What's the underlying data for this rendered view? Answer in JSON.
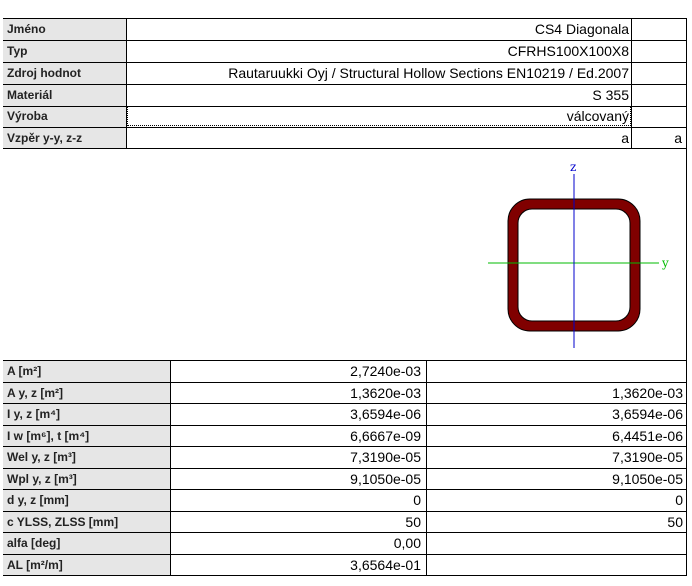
{
  "header_rows": [
    {
      "label": "Jméno",
      "value": "CS4 Diagonala"
    },
    {
      "label": "Typ",
      "value": "CFRHS100X100X8"
    },
    {
      "label": "Zdroj hodnot",
      "value": "Rautaruukki Oyj / Structural Hollow Sections EN10219 / Ed.2007"
    },
    {
      "label": "Materiál",
      "value": "S 355"
    },
    {
      "label": "Výroba",
      "value": "válcovaný"
    },
    {
      "label": "Vzpěr y-y, z-z",
      "value": "a",
      "value2": "a"
    }
  ],
  "diagram": {
    "axis_z_label": "z",
    "axis_y_label": "y",
    "section_color": "#800000",
    "axis_z_color": "#0000cc",
    "axis_y_color": "#00bb00"
  },
  "properties": [
    {
      "label": "A [m²]",
      "value1": "2,7240e-03",
      "value2": ""
    },
    {
      "label": "A y, z [m²]",
      "value1": "1,3620e-03",
      "value2": "1,3620e-03"
    },
    {
      "label": "I y, z [m⁴]",
      "value1": "3,6594e-06",
      "value2": "3,6594e-06"
    },
    {
      "label": "I w [m⁶], t [m⁴]",
      "value1": "6,6667e-09",
      "value2": "6,4451e-06"
    },
    {
      "label": "Wel y, z [m³]",
      "value1": "7,3190e-05",
      "value2": "7,3190e-05"
    },
    {
      "label": "Wpl y, z [m³]",
      "value1": "9,1050e-05",
      "value2": "9,1050e-05"
    },
    {
      "label": "d y, z [mm]",
      "value1": "0",
      "value2": "0"
    },
    {
      "label": "c YLSS, ZLSS [mm]",
      "value1": "50",
      "value2": "50"
    },
    {
      "label": "alfa [deg]",
      "value1": "0,00",
      "value2": ""
    },
    {
      "label": "AL [m²/m]",
      "value1": "3,6564e-01",
      "value2": ""
    }
  ]
}
